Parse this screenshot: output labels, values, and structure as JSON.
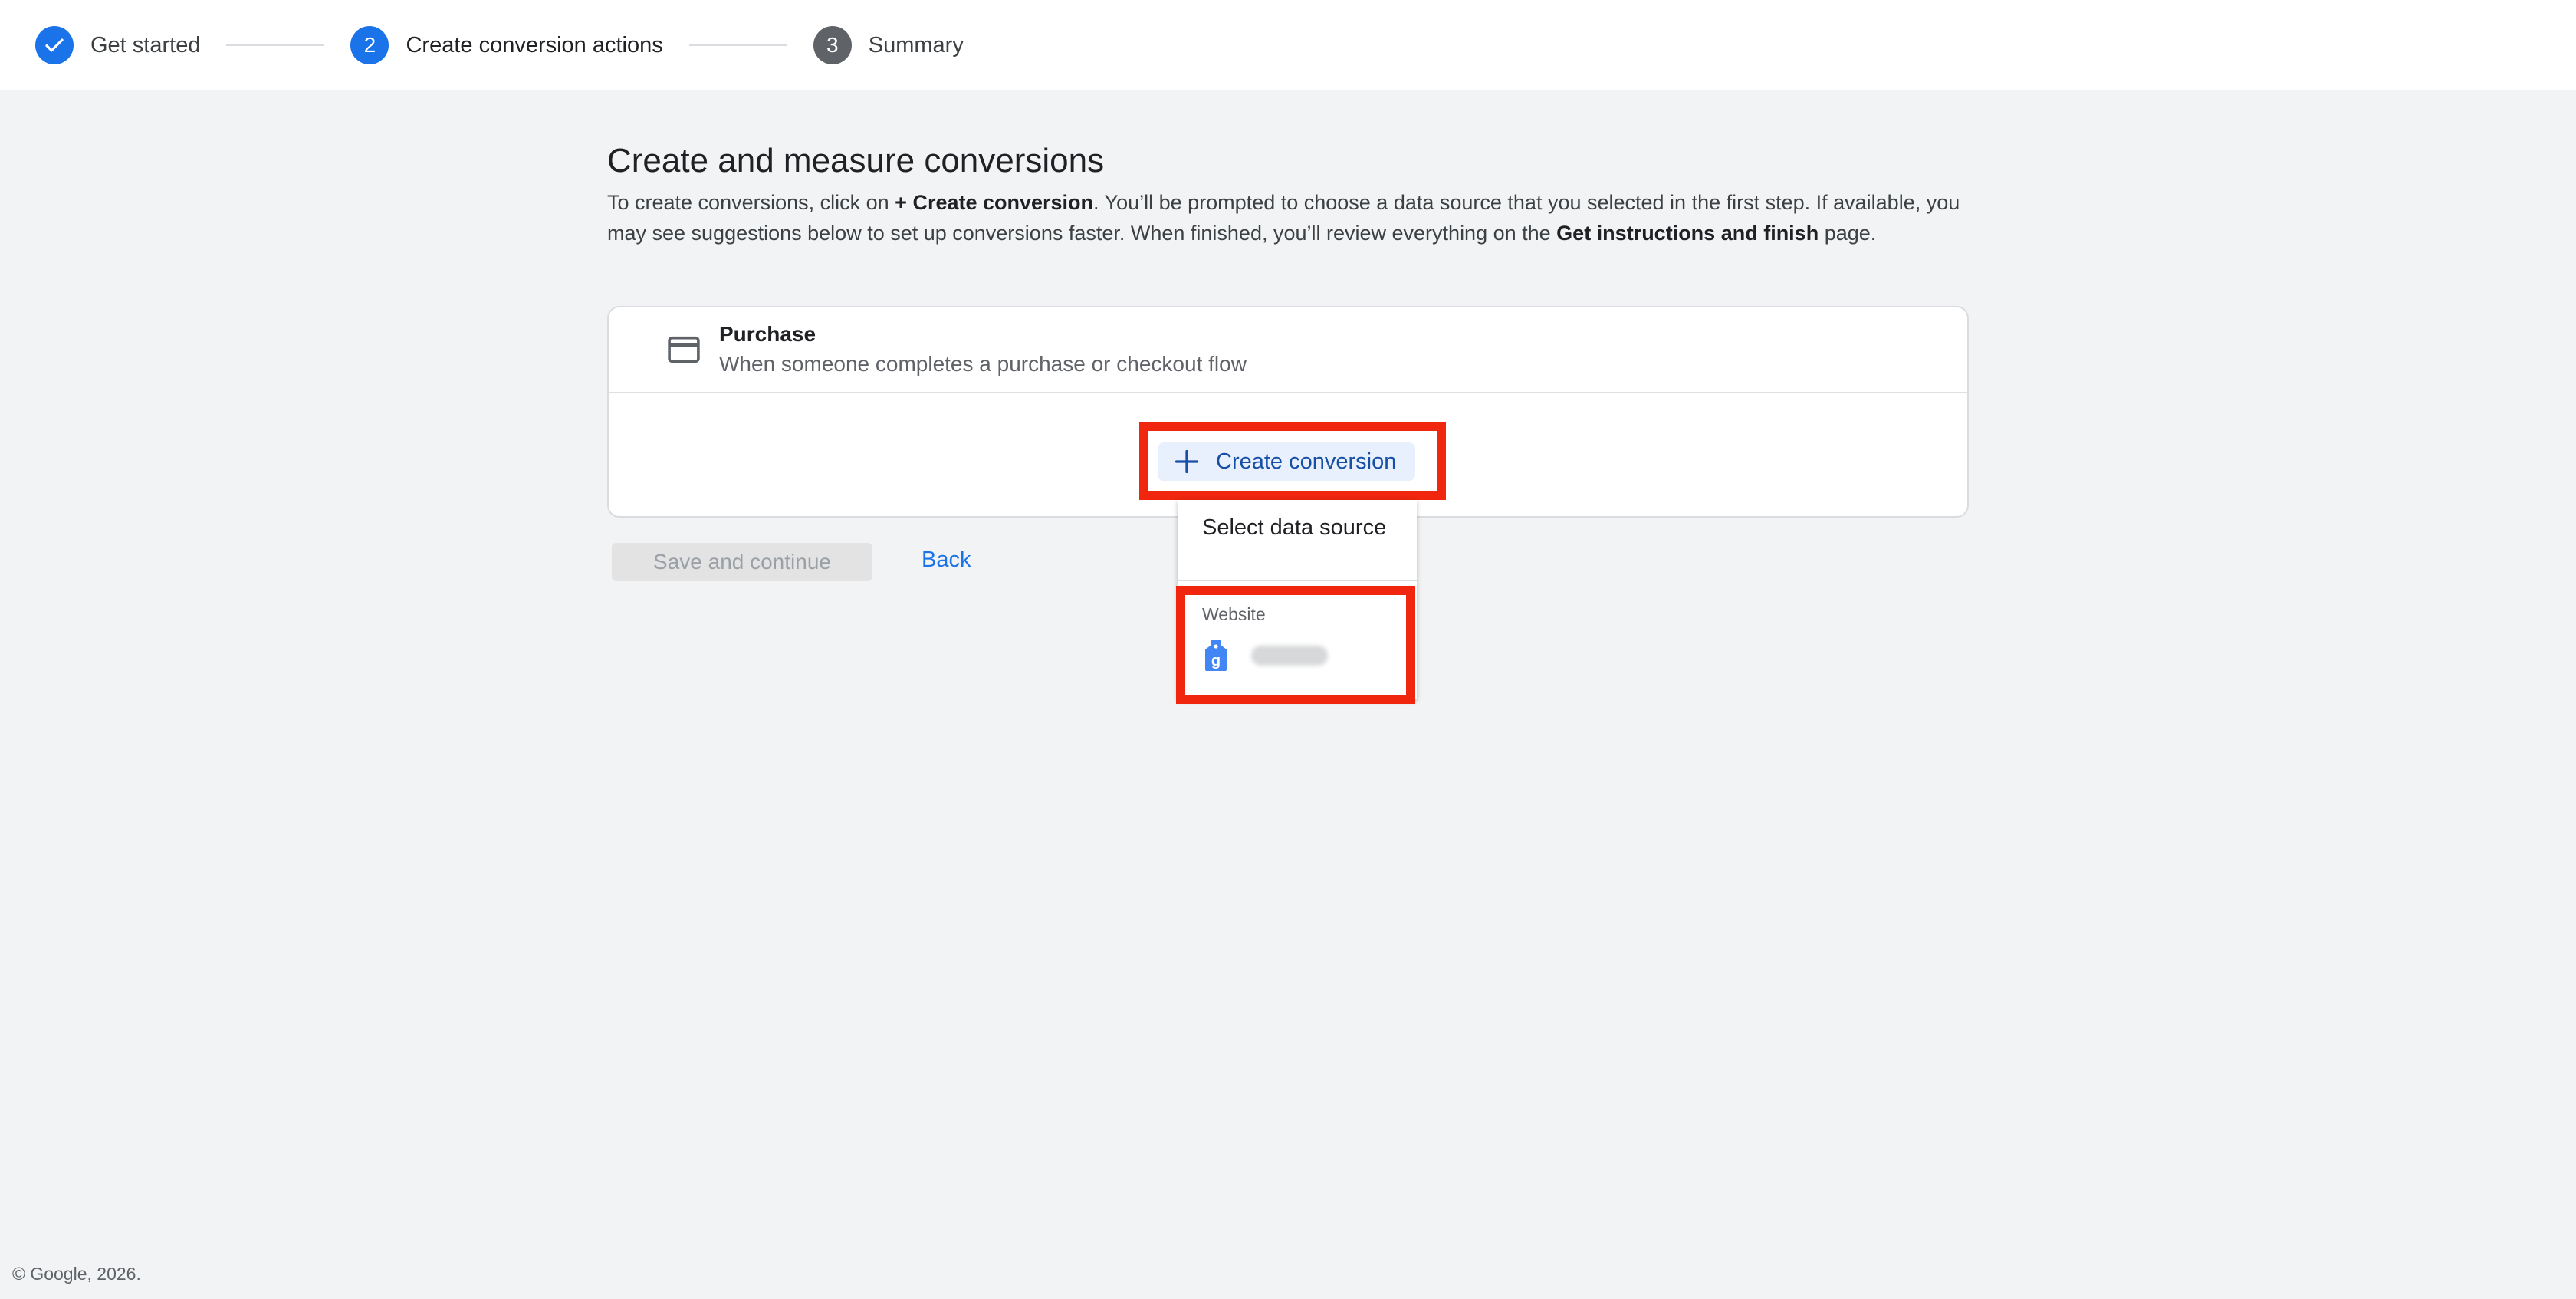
{
  "stepper": {
    "steps": [
      {
        "number": "",
        "label": "Get started",
        "state": "done",
        "icon": "check-icon"
      },
      {
        "number": "2",
        "label": "Create conversion actions",
        "state": "active"
      },
      {
        "number": "3",
        "label": "Summary",
        "state": "pending"
      }
    ]
  },
  "main": {
    "title": "Create and measure conversions",
    "desc_1": "To create conversions, click on ",
    "desc_bold_1": "+ Create conversion",
    "desc_2": ". You’ll be prompted to choose a data source that you selected in the first step. If available, you may see suggestions below to set up conversions faster. When finished, you’ll review everything on the ",
    "desc_bold_2": "Get instructions and finish",
    "desc_3": " page."
  },
  "card": {
    "icon": "credit-card-icon",
    "title": "Purchase",
    "subtitle": "When someone completes a purchase or checkout flow",
    "create_button": "Create conversion"
  },
  "dropdown": {
    "title": "Select data source",
    "section": "Website",
    "item_icon": "google-tag-icon"
  },
  "actions": {
    "save": "Save and continue",
    "back": "Back"
  },
  "footer": "© Google, 2026.",
  "colors": {
    "accent": "#1a73e8",
    "highlight": "#f0260f",
    "background": "#f1f3f4"
  }
}
